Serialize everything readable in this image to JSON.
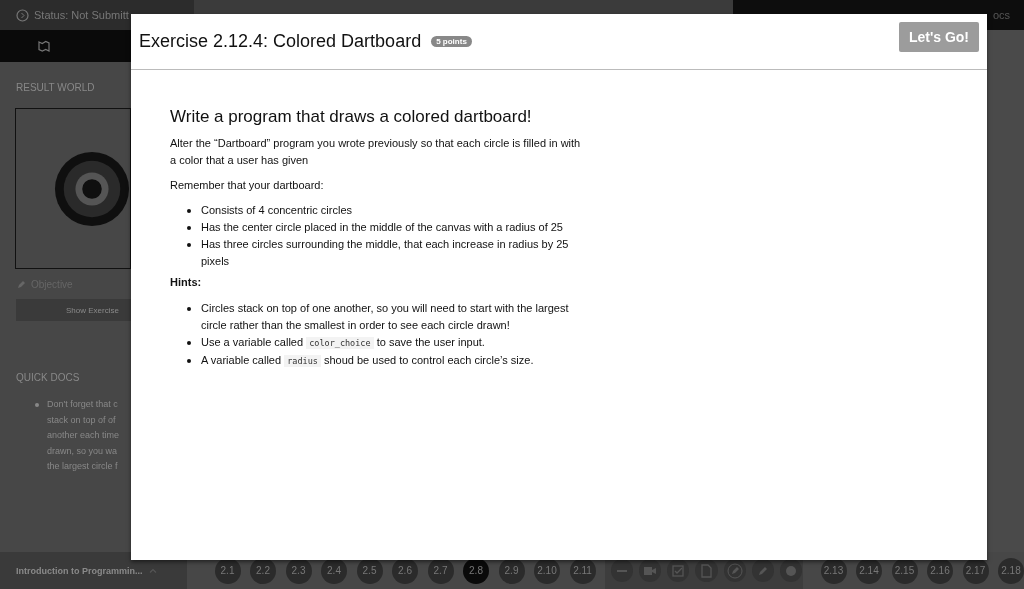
{
  "top_bar": {
    "status": "Status: Not Submitt",
    "docs_link": "ocs"
  },
  "sidebar": {
    "section_title": "RESULT WORLD",
    "objective": "Objective",
    "show_button": "Show Exercise",
    "quick_docs": {
      "heading": "QUICK DOCS",
      "lines": [
        "Don't forget that c",
        "stack on top of of",
        "another each time",
        "drawn, so you wa",
        "the largest circle f"
      ]
    }
  },
  "bottom_bar": {
    "course": "Introduction to Programmin...",
    "steps_left": [
      {
        "label": "2.1",
        "selected": false
      },
      {
        "label": "2.2",
        "selected": false
      },
      {
        "label": "2.3",
        "selected": false
      },
      {
        "label": "2.4",
        "selected": false
      },
      {
        "label": "2.5",
        "selected": false
      },
      {
        "label": "2.6",
        "selected": false
      },
      {
        "label": "2.7",
        "selected": false
      },
      {
        "label": "2.8",
        "selected": true
      },
      {
        "label": "2.9",
        "selected": false
      },
      {
        "label": "2.10",
        "selected": false
      },
      {
        "label": "2.11",
        "selected": false
      }
    ],
    "tools": [
      {
        "kind": "minus"
      },
      {
        "kind": "video"
      },
      {
        "kind": "check"
      },
      {
        "kind": "doc"
      },
      {
        "kind": "pencil-ring"
      },
      {
        "kind": "pencil"
      },
      {
        "kind": "dot"
      }
    ],
    "steps_right": [
      {
        "label": "2.13",
        "selected": false
      },
      {
        "label": "2.14",
        "selected": false
      },
      {
        "label": "2.15",
        "selected": false
      },
      {
        "label": "2.16",
        "selected": false
      },
      {
        "label": "2.17",
        "selected": false
      },
      {
        "label": "2.18",
        "selected": false
      }
    ]
  },
  "modal": {
    "title": "Exercise 2.12.4: Colored Dartboard",
    "badge": "5 points",
    "button": "Let's Go!",
    "heading": "Write a program that draws a colored dartboard!",
    "intro": "Alter the “Dartboard” program you wrote previously so that each circle is filled in with a color that a user has given",
    "remember": "Remember that your dartboard:",
    "requirements": [
      "Consists of 4 concentric circles",
      "Has the center circle placed in the middle of the canvas with a radius of 25",
      "Has three circles surrounding the middle, that each increase in radius by 25 pixels"
    ],
    "hints_title": "Hints:",
    "hints": [
      [
        {
          "kind": "text",
          "text": "Circles stack on top of one another, so you will need to start with the largest circle rather than the smallest in order to see each circle drawn!"
        }
      ],
      [
        {
          "kind": "text",
          "text": "Use a variable called "
        },
        {
          "kind": "code",
          "text": "color_choice"
        },
        {
          "kind": "text",
          "text": " to save the user input."
        }
      ],
      [
        {
          "kind": "text",
          "text": "A variable called "
        },
        {
          "kind": "code",
          "text": "radius"
        },
        {
          "kind": "text",
          "text": " shoud be used to control each circle’s size."
        }
      ]
    ]
  }
}
